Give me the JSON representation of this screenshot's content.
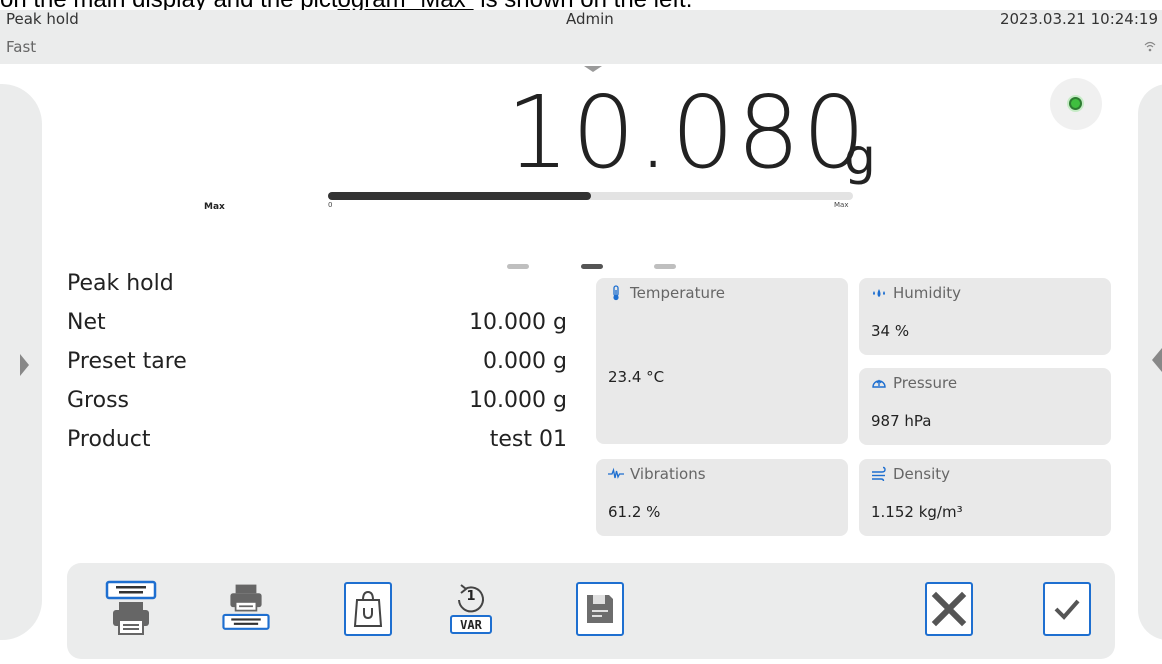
{
  "doc_caption": {
    "pre": "on the main display and the pict",
    "underlined": "ogram “Max”",
    "post": " is shown on the left."
  },
  "topbar": {
    "mode": "Peak hold",
    "speed": "Fast",
    "user": "Admin",
    "clock": "2023.03.21 10:24:19",
    "wifi_icon": "wifi-icon"
  },
  "weighing": {
    "value": "10.080",
    "unit": "g",
    "pictogram": "Max",
    "bar_min": "0",
    "bar_max": "Max",
    "bar_fill_fraction": 0.5,
    "status_color": "#3fbf3f"
  },
  "pager": {
    "count": 3,
    "active_index": 1
  },
  "info_rows": [
    {
      "label": "Peak hold",
      "value": ""
    },
    {
      "label": "Net",
      "value": "10.000 g"
    },
    {
      "label": "Preset tare",
      "value": "0.000 g"
    },
    {
      "label": "Gross",
      "value": "10.000 g"
    },
    {
      "label": "Product",
      "value": "test 01"
    }
  ],
  "tiles": {
    "temperature": {
      "title": "Temperature",
      "value": "23.4 °C",
      "icon": "thermometer-icon"
    },
    "humidity": {
      "title": "Humidity",
      "value": "34 %",
      "icon": "droplets-icon"
    },
    "pressure": {
      "title": "Pressure",
      "value": "987 hPa",
      "icon": "gauge-icon"
    },
    "vibrations": {
      "title": "Vibrations",
      "value": "61.2 %",
      "icon": "vibration-icon"
    },
    "density": {
      "title": "Density",
      "value": "1.152 kg/m³",
      "icon": "wind-icon"
    }
  },
  "footer": {
    "var_label": "VAR",
    "var_counter": "1",
    "accent": "#1e6fd0"
  }
}
